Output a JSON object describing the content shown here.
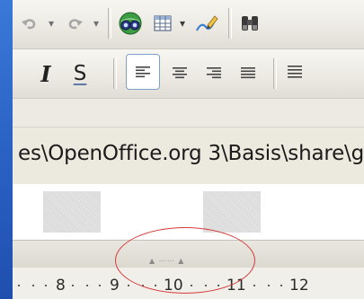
{
  "toolbar_formatting": {
    "italic_label": "I",
    "shadow_label": "S"
  },
  "path_bar": {
    "text": "es\\OpenOffice.org 3\\Basis\\share\\g"
  },
  "ruler": {
    "numbers": [
      "8",
      "9",
      "10",
      "11",
      "12"
    ]
  },
  "colors": {
    "highlight": "#d63a3a",
    "background_blue": "#2a62c4"
  }
}
